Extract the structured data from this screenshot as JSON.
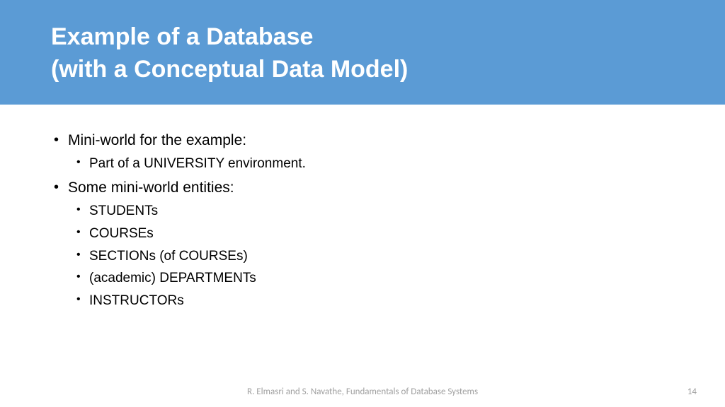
{
  "header": {
    "title_line1": "Example of a Database",
    "title_line2": "(with a Conceptual Data Model)"
  },
  "content": {
    "bullets": [
      {
        "level": 1,
        "text": "Mini-world for the example:"
      },
      {
        "level": 2,
        "text": "Part of a UNIVERSITY environment."
      },
      {
        "level": 1,
        "text": "Some mini-world entities:"
      },
      {
        "level": 2,
        "text": "STUDENTs"
      },
      {
        "level": 2,
        "text": "COURSEs"
      },
      {
        "level": 2,
        "text": "SECTIONs (of COURSEs)"
      },
      {
        "level": 2,
        "text": "(academic) DEPARTMENTs"
      },
      {
        "level": 2,
        "text": "INSTRUCTORs"
      }
    ]
  },
  "footer": {
    "attribution": "R. Elmasri and S. Navathe, Fundamentals of Database Systems",
    "page_number": "14"
  }
}
